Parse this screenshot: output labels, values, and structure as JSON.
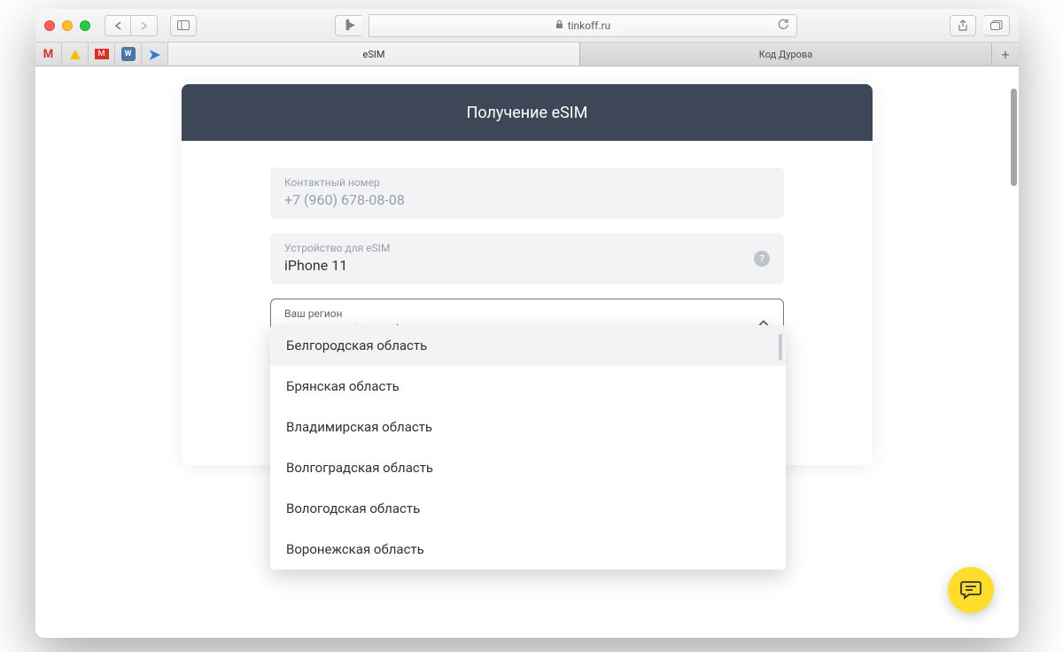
{
  "browser": {
    "url_host": "tinkoff.ru",
    "tabs": [
      {
        "label": "eSIM",
        "active": true
      },
      {
        "label": "Код Дурова",
        "active": false
      }
    ],
    "favorites": [
      "gmail",
      "drive",
      "gmail-red",
      "vk",
      "arrow"
    ]
  },
  "card": {
    "title": "Получение eSIM",
    "contact": {
      "label": "Контактный номер",
      "value": "+7 (960) 678-08-08"
    },
    "device": {
      "label": "Устройство для eSIM",
      "value": "iPhone 11"
    },
    "region": {
      "label": "Ваш регион",
      "value": "Курская область"
    },
    "dropdown_options": [
      "Белгородская область",
      "Брянская область",
      "Владимирская область",
      "Волгоградская область",
      "Вологодская область",
      "Воронежская область"
    ]
  }
}
